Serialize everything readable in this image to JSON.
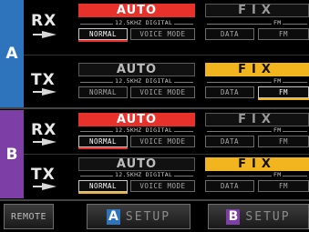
{
  "sections": [
    {
      "label": "A",
      "color": "#2e74bd",
      "rows": [
        {
          "dir": "RX",
          "auto": "AUTO",
          "auto_active": true,
          "fix": "FIX",
          "fix_active": false,
          "step_label": "12.5KHZ DIGITAL",
          "fm_label": "FM",
          "normal": "NORMAL",
          "voice": "VOICE MODE",
          "data": "DATA",
          "fm": "FM",
          "normal_selected": true,
          "fm_selected": false
        },
        {
          "dir": "TX",
          "auto": "AUTO",
          "auto_active": false,
          "fix": "FIX",
          "fix_active": true,
          "step_label": "12.5KHZ DIGITAL",
          "fm_label": "FM",
          "normal": "NORMAL",
          "voice": "VOICE MODE",
          "data": "DATA",
          "fm": "FM",
          "normal_selected": false,
          "fm_selected": true
        }
      ]
    },
    {
      "label": "B",
      "color": "#7d3fa5",
      "rows": [
        {
          "dir": "RX",
          "auto": "AUTO",
          "auto_active": true,
          "fix": "FIX",
          "fix_active": false,
          "step_label": "12.5KHZ DIGITAL",
          "fm_label": "FM",
          "normal": "NORMAL",
          "voice": "VOICE MODE",
          "data": "DATA",
          "fm": "FM",
          "normal_selected": true,
          "fm_selected": false
        },
        {
          "dir": "TX",
          "auto": "AUTO",
          "auto_active": false,
          "fix": "FIX",
          "fix_active": true,
          "step_label": "12.5KHZ DIGITAL",
          "fm_label": "FM",
          "normal": "NORMAL",
          "voice": "VOICE MODE",
          "data": "DATA",
          "fm": "FM",
          "normal_selected": true,
          "fm_selected": false
        }
      ]
    }
  ],
  "bottom": {
    "remote": "REMOTE",
    "setup_a_badge": "A",
    "setup_a": "SETUP",
    "setup_b_badge": "B",
    "setup_b": "SETUP"
  },
  "colors": {
    "auto_active": "#e8312b",
    "fix_active": "#f2b51f",
    "band_a": "#2e74bd",
    "band_b": "#7d3fa5"
  }
}
